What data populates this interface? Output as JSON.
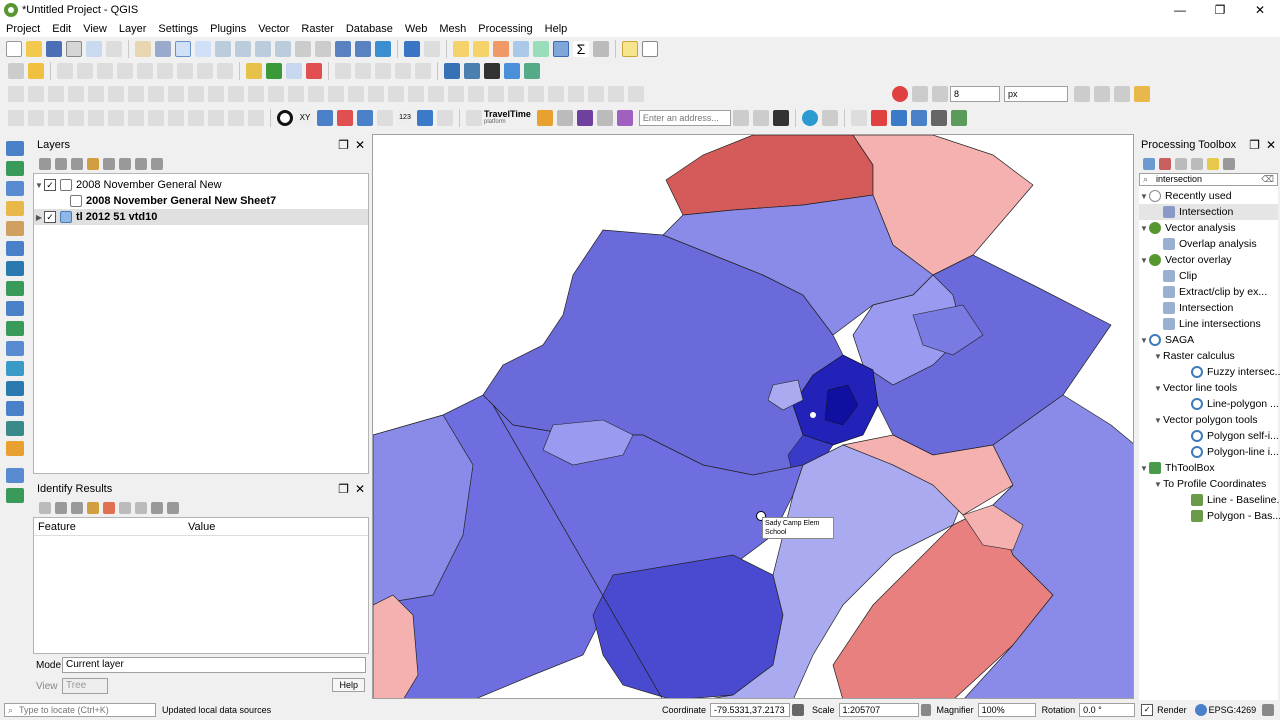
{
  "window": {
    "title": "*Untitled Project - QGIS",
    "min": "—",
    "max": "❐",
    "close": "✕"
  },
  "menu": [
    "Project",
    "Edit",
    "View",
    "Layer",
    "Settings",
    "Plugins",
    "Vector",
    "Raster",
    "Database",
    "Web",
    "Mesh",
    "Processing",
    "Help"
  ],
  "toolbar": {
    "snap_value": "8",
    "snap_unit": "px",
    "address_placeholder": "Enter an address...",
    "traveltime_label": "TravelTime",
    "traveltime_sub": "platform",
    "xy_label": "XY",
    "num_label": "123"
  },
  "layers_panel": {
    "title": "Layers",
    "items": [
      {
        "label": "2008 November General New",
        "checked": true,
        "bold": false
      },
      {
        "label": "2008 November General New Sheet7",
        "checked": false,
        "bold": true
      },
      {
        "label": "tl 2012 51 vtd10",
        "checked": true,
        "bold": true
      }
    ]
  },
  "identify_panel": {
    "title": "Identify Results",
    "col_feature": "Feature",
    "col_value": "Value",
    "mode_label": "Mode",
    "mode_value": "Current layer",
    "view_label": "View",
    "view_value": "Tree",
    "help_label": "Help"
  },
  "map": {
    "tooltip_line1": "Sady Camp Elem",
    "tooltip_line2": "School",
    "colors": {
      "dark_blue": "#1010b0",
      "mid_blue": "#5555d5",
      "light_blue": "#a8a8ee",
      "light_red": "#f5b0b0",
      "mid_red": "#e88080",
      "dark_red": "#d55a5a"
    }
  },
  "processing": {
    "title": "Processing Toolbox",
    "search_value": "intersection",
    "groups": [
      {
        "label": "Recently used",
        "items": [
          "Intersection"
        ]
      },
      {
        "label": "Vector analysis",
        "items": [
          "Overlap analysis"
        ]
      },
      {
        "label": "Vector overlay",
        "items": [
          "Clip",
          "Extract/clip by ex...",
          "Intersection",
          "Line intersections"
        ]
      }
    ],
    "saga": {
      "label": "SAGA",
      "subgroups": [
        {
          "label": "Raster calculus",
          "items": [
            "Fuzzy intersec..."
          ]
        },
        {
          "label": "Vector line tools",
          "items": [
            "Line-polygon ..."
          ]
        },
        {
          "label": "Vector polygon tools",
          "items": [
            "Polygon self-i...",
            "Polygon-line i..."
          ]
        }
      ]
    },
    "thtoolbox": {
      "label": "ThToolBox",
      "subgroups": [
        {
          "label": "To Profile Coordinates",
          "items": [
            "Line - Baseline...",
            "Polygon - Bas..."
          ]
        }
      ]
    }
  },
  "status": {
    "locate_placeholder": "Type to locate (Ctrl+K)",
    "message": "Updated local data sources",
    "coord_label": "Coordinate",
    "coord_value": "-79.5331,37.2173",
    "scale_label": "Scale",
    "scale_value": "1:205707",
    "magnifier_label": "Magnifier",
    "magnifier_value": "100%",
    "rotation_label": "Rotation",
    "rotation_value": "0.0 °",
    "render_label": "Render",
    "crs_label": "EPSG:4269"
  }
}
